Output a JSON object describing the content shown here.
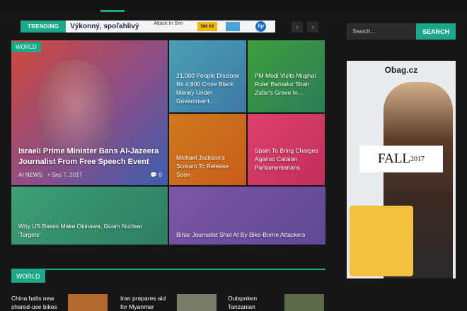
{
  "trending": {
    "label": "TRENDING",
    "banner_text": "Výkonný, spoľahlivý",
    "banner_ticker": "Attack In Srin",
    "banner_price": "500 Kč",
    "banner_brand": "hp"
  },
  "nav_arrows": {
    "prev": "‹",
    "next": "›"
  },
  "search": {
    "placeholder": "Search...",
    "button": "SEARCH"
  },
  "featured": {
    "main": {
      "category": "WORLD",
      "title": "Israeli Prime Minister Bans Al-Jazeera Journalist From Free Speech Event",
      "author": "AI NEWS",
      "date": "Sep 7, 2017",
      "comments": "0"
    },
    "tiles": [
      {
        "title": "21,000 People Disclose Rs 4,900 Crore Black Money Under Government…"
      },
      {
        "title": "PM Modi Visits Mughal Ruler Bahadur Shah Zafar's Grave In…"
      },
      {
        "title": "Michael Jackson's Scream To Release Soon"
      },
      {
        "title": "Spain To Bring Charges Against Catalan Parliamentarians"
      },
      {
        "title": "Why US Bases Make Okinawa, Guam Nuclear 'Targets'"
      },
      {
        "title": "Bihar Journalist Shot At By Bike-Borne Attackers"
      }
    ]
  },
  "ad": {
    "logo": "Obag.cz",
    "headline": "FALL",
    "year": "2017"
  },
  "section": {
    "label": "WORLD"
  },
  "world_list": [
    {
      "title": "China halts new shared-use bikes"
    },
    {
      "title": "Iran prepares aid for Myanmar"
    },
    {
      "title": "Outspoken Tanzanian"
    }
  ],
  "colors": {
    "accent": "#1aa889",
    "background": "#161617"
  }
}
